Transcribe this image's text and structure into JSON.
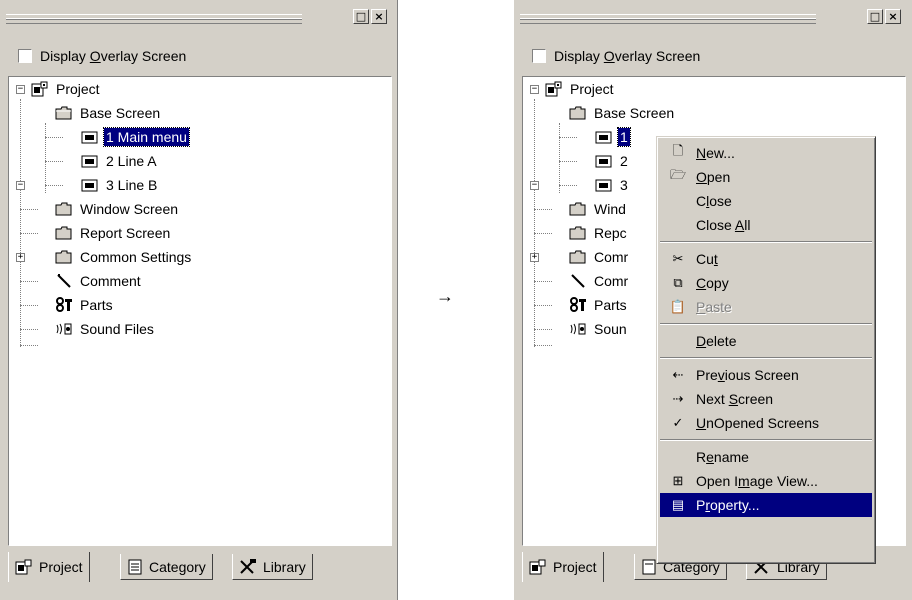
{
  "checkbox_label": {
    "pre": "Display ",
    "key": "O",
    "post": "verlay Screen"
  },
  "window_buttons": {
    "maximize": "□",
    "close": "×"
  },
  "tree": {
    "project": "Project",
    "base_screen": "Base Screen",
    "main_menu": "1 Main menu",
    "line_a": "2 Line A",
    "line_b": "3 Line B",
    "window_screen": "Window Screen",
    "report_screen": "Report Screen",
    "common_settings": "Common Settings",
    "comment": "Comment",
    "parts": "Parts",
    "sound_files": "Sound Files"
  },
  "tree_truncated": {
    "main_menu": "1",
    "line_a": "2",
    "line_b": "3",
    "window_screen": "Wind",
    "report_screen": "Repc",
    "common_settings": "Comr",
    "comment": "Comr",
    "parts": "Parts",
    "sound_files": "Soun"
  },
  "tabs": [
    {
      "label": "Project"
    },
    {
      "label": "Category"
    },
    {
      "label": "Library"
    }
  ],
  "arrow": "→",
  "context_menu": {
    "new": {
      "key": "N",
      "rest": "ew..."
    },
    "open": {
      "key": "O",
      "rest": "pen"
    },
    "close": {
      "pre": "C",
      "key": "l",
      "post": "ose"
    },
    "close_all": {
      "pre": "Close ",
      "key": "A",
      "post": "ll"
    },
    "cut": {
      "pre": "Cu",
      "key": "t",
      "post": ""
    },
    "copy": {
      "key": "C",
      "rest": "opy"
    },
    "paste": {
      "key": "P",
      "rest": "aste"
    },
    "delete": {
      "key": "D",
      "rest": "elete"
    },
    "previous_screen": {
      "pre": "Pre",
      "key": "v",
      "post": "ious Screen"
    },
    "next_screen": {
      "pre": "Next ",
      "key": "S",
      "post": "creen"
    },
    "unopened_screens": {
      "key": "U",
      "rest": "nOpened Screens"
    },
    "rename": {
      "pre": "R",
      "key": "e",
      "post": "name"
    },
    "open_image_view": {
      "pre": "Open I",
      "key": "m",
      "post": "age View..."
    },
    "property": {
      "pre": "P",
      "key": "r",
      "post": "operty..."
    }
  },
  "colors": {
    "selection": "#000080",
    "face": "#d4d0c8"
  }
}
